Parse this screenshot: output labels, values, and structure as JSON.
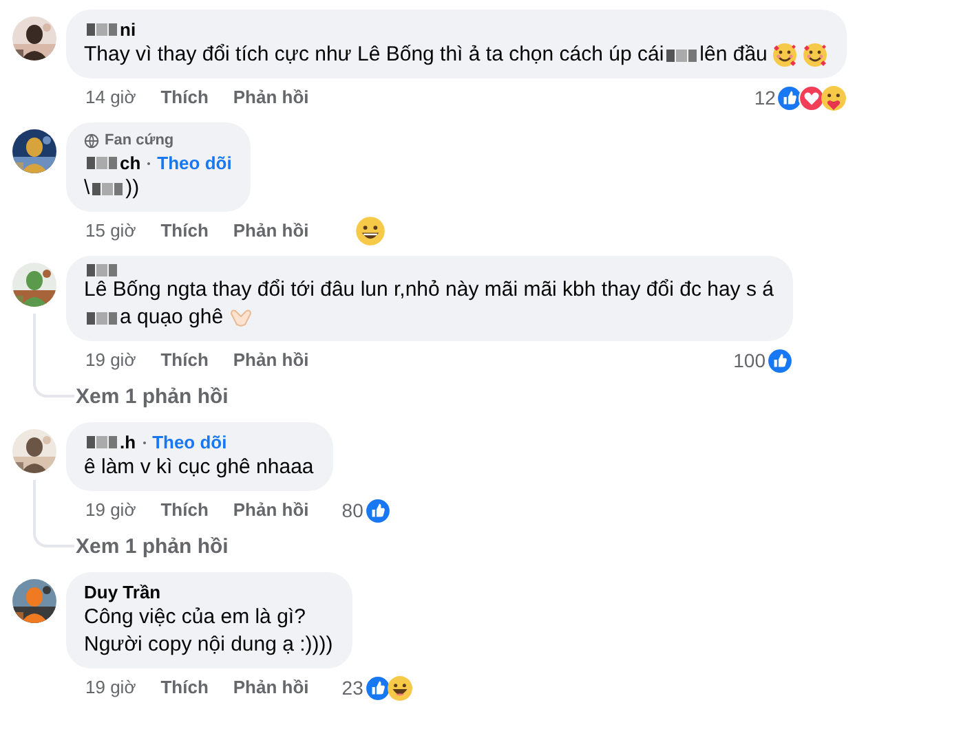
{
  "comments": [
    {
      "avatar": {
        "kind": "picture"
      },
      "name": [
        {
          "kind": "blur"
        },
        {
          "kind": "text",
          "text": "ni"
        }
      ],
      "lines": [
        [
          {
            "kind": "text",
            "text": "Thay vì thay đổi tích cực như Lê Bống thì ả ta chọn cách úp cái"
          },
          {
            "kind": "blur"
          },
          {
            "kind": "text",
            "text": " lên đầu"
          },
          {
            "kind": "hearts"
          },
          {
            "kind": "hearts"
          }
        ]
      ],
      "time": "14 giờ",
      "like": "Thích",
      "reply": "Phản hồi",
      "count": "12",
      "reactions": [
        {
          "kind": "like"
        },
        {
          "kind": "love"
        },
        {
          "kind": "care"
        }
      ]
    },
    {
      "avatar": {
        "kind": "picture"
      },
      "badge": "Fan cứng",
      "name": [
        {
          "kind": "blur"
        },
        {
          "kind": "text",
          "text": "ch"
        }
      ],
      "follow": "Theo dõi",
      "lines": [
        [
          {
            "kind": "text",
            "text": "\\"
          },
          {
            "kind": "blur"
          },
          {
            "kind": "text",
            "text": "))"
          }
        ]
      ],
      "time": "15 giờ",
      "like": "Thích",
      "reply": "Phản hồi",
      "reactions": [
        {
          "kind": "haha"
        }
      ]
    },
    {
      "avatar": {
        "kind": "picture"
      },
      "name": [
        {
          "kind": "blur"
        }
      ],
      "lines": [
        [
          {
            "kind": "text",
            "text": "Lê Bống ngta thay đổi tới đâu lun r,nhỏ này mãi mãi kbh thay đổi đc hay s á"
          }
        ],
        [
          {
            "kind": "blur"
          },
          {
            "kind": "text",
            "text": "a quạo ghê"
          },
          {
            "kind": "hands"
          }
        ]
      ],
      "time": "19 giờ",
      "like": "Thích",
      "reply": "Phản hồi",
      "count": "100",
      "reactions": [
        {
          "kind": "like"
        }
      ],
      "more": "Xem 1 phản hồi"
    },
    {
      "avatar": {
        "kind": "picture"
      },
      "name": [
        {
          "kind": "blur"
        },
        {
          "kind": "text",
          "text": ".h"
        }
      ],
      "follow": "Theo dõi",
      "lines": [
        [
          {
            "kind": "text",
            "text": "ê làm v kì cục ghê nhaaa"
          }
        ]
      ],
      "time": "19 giờ",
      "like": "Thích",
      "reply": "Phản hồi",
      "count": "80",
      "reactions": [
        {
          "kind": "like"
        }
      ],
      "more": "Xem 1 phản hồi"
    },
    {
      "avatar": {
        "kind": "picture"
      },
      "name": [
        {
          "kind": "text",
          "text": "Duy Trần"
        }
      ],
      "lines": [
        [
          {
            "kind": "text",
            "text": "Công việc của em là gì?"
          }
        ],
        [
          {
            "kind": "text",
            "text": "Người copy nội dung ạ :))))"
          }
        ]
      ],
      "time": "19 giờ",
      "like": "Thích",
      "reply": "Phản hồi",
      "count": "23",
      "reactions": [
        {
          "kind": "like"
        },
        {
          "kind": "haha"
        }
      ]
    }
  ]
}
